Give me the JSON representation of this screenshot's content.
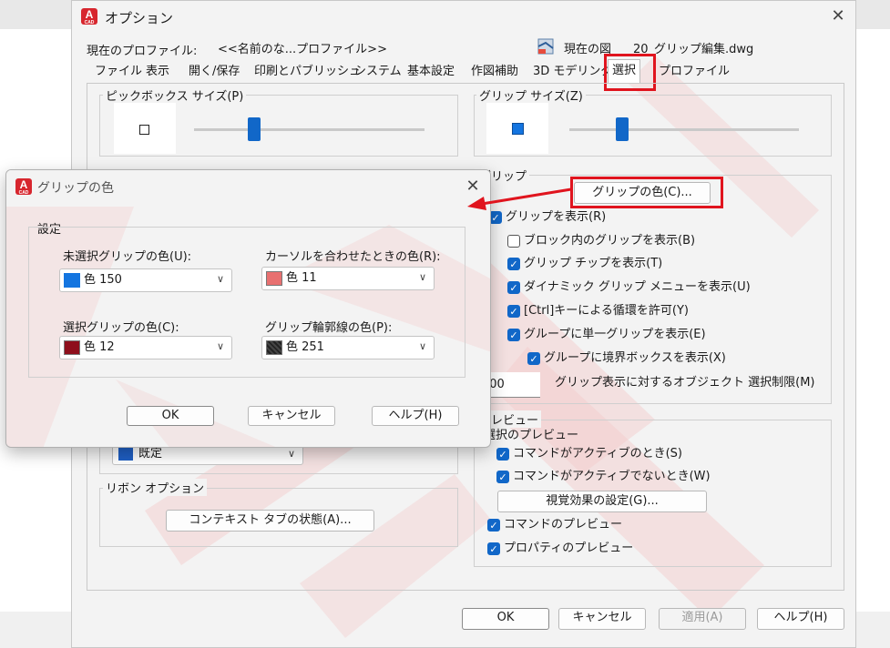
{
  "main_window": {
    "title": "オプション",
    "profile_label": "現在のプロファイル:",
    "profile_value": "<<名前のな...プロファイル>>",
    "drawing_label": "現在の図",
    "drawing_value": "20_グリップ編集.dwg",
    "tabs": [
      {
        "label": "ファイル"
      },
      {
        "label": "表示"
      },
      {
        "label": "開く/保存"
      },
      {
        "label": "印刷とパブリッシュ"
      },
      {
        "label": "システム"
      },
      {
        "label": "基本設定"
      },
      {
        "label": "作図補助"
      },
      {
        "label": "3D モデリング"
      },
      {
        "label": "選択"
      },
      {
        "label": "プロファイル"
      }
    ],
    "active_tab": "選択",
    "pickbox_group": "ピックボックス サイズ(P)",
    "grip_size_group": "グリップ サイズ(Z)",
    "grips_group": "グリップ",
    "grip_color_button": "グリップの色(C)...",
    "grip_checkboxes": [
      {
        "label": "グリップを表示(R)",
        "checked": true
      },
      {
        "label": "ブロック内のグリップを表示(B)",
        "checked": false
      },
      {
        "label": "グリップ チップを表示(T)",
        "checked": true
      },
      {
        "label": "ダイナミック グリップ メニューを表示(U)",
        "checked": true
      },
      {
        "label": "[Ctrl]キーによる循環を許可(Y)",
        "checked": true
      },
      {
        "label": "グループに単一グリップを表示(E)",
        "checked": true
      },
      {
        "label": "グループに境界ボックスを表示(X)",
        "checked": true
      }
    ],
    "grip_limit_value": "100",
    "grip_limit_label": "グリップ表示に対するオブジェクト 選択制限(M)",
    "preview_group": "プレビュー",
    "selection_preview_label": "選択のプレビュー",
    "preview_checkboxes": [
      {
        "label": "コマンドがアクティブのとき(S)",
        "checked": true
      },
      {
        "label": "コマンドがアクティブでないとき(W)",
        "checked": true
      }
    ],
    "visual_effects_button": "視覚効果の設定(G)...",
    "command_preview": {
      "label": "コマンドのプレビュー",
      "checked": true
    },
    "property_preview": {
      "label": "プロパティのプレビュー",
      "checked": true
    },
    "selection_color_value": "既定",
    "ribbon_group": "リボン オプション",
    "contextual_tab_button": "コンテキスト タブの状態(A)...",
    "buttons": {
      "ok": "OK",
      "cancel": "キャンセル",
      "apply": "適用(A)",
      "help": "ヘルプ(H)"
    }
  },
  "grip_dialog": {
    "title": "グリップの色",
    "settings_label": "設定",
    "unselected_label": "未選択グリップの色(U):",
    "unselected_value": "色 150",
    "hover_label": "カーソルを合わせたときの色(R):",
    "hover_value": "色 11",
    "selected_label": "選択グリップの色(C):",
    "selected_value": "色 12",
    "outline_label": "グリップ輪郭線の色(P):",
    "outline_value": "色 251",
    "buttons": {
      "ok": "OK",
      "cancel": "キャンセル",
      "help": "ヘルプ(H)"
    }
  },
  "colors": {
    "accent": "#1167c8",
    "highlight_red": "#e0141e",
    "swatch_unselected": "#1475e0",
    "swatch_hover": "#e87070",
    "swatch_selected": "#8e0f1c",
    "swatch_outline": "#2a2a2a",
    "swatch_selection": "#1f5fc4"
  },
  "icons": [
    "autocad-app-icon",
    "close-icon",
    "drawing-file-icon",
    "chevron-down-icon",
    "arrow-annotation-icon"
  ]
}
